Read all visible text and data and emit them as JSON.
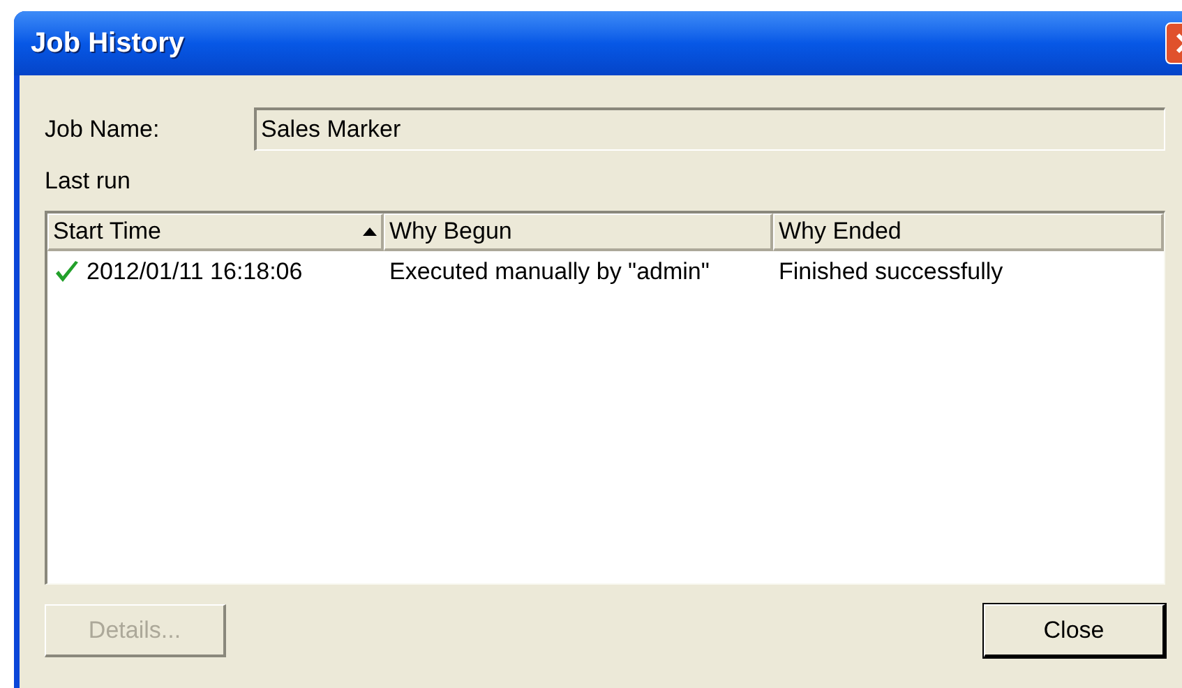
{
  "window": {
    "title": "Job History"
  },
  "job_name": {
    "label": "Job Name:",
    "value": "Sales Marker"
  },
  "section_label": "Last run",
  "table": {
    "columns": [
      {
        "label": "Start Time",
        "sorted": true
      },
      {
        "label": "Why Begun",
        "sorted": false
      },
      {
        "label": "Why Ended",
        "sorted": false
      }
    ],
    "rows": [
      {
        "succeeded": true,
        "cells": [
          "2012/01/11 16:18:06",
          "Executed manually by \"admin\"",
          "Finished successfully"
        ]
      }
    ]
  },
  "buttons": [
    {
      "label": "Details...",
      "disabled": true,
      "default": false
    },
    {
      "label": "Close",
      "disabled": false,
      "default": true
    }
  ]
}
